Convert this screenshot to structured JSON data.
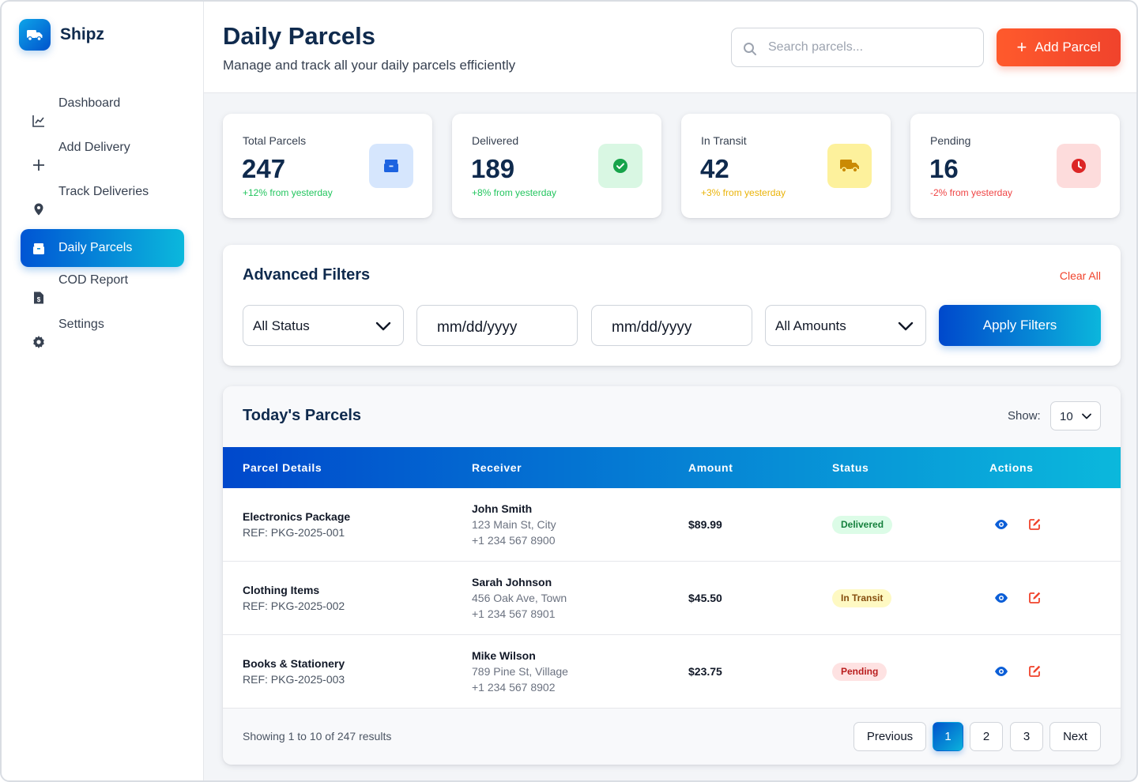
{
  "brand": {
    "name": "Shipz"
  },
  "sidebar": {
    "items": [
      {
        "label": "Dashboard",
        "icon": "chart-line-icon"
      },
      {
        "label": "Add Delivery",
        "icon": "plus-icon"
      },
      {
        "label": "Track Deliveries",
        "icon": "map-pin-icon"
      },
      {
        "label": "Daily Parcels",
        "icon": "box-icon",
        "active": true
      },
      {
        "label": "COD Report",
        "icon": "invoice-dollar-icon"
      },
      {
        "label": "Settings",
        "icon": "gear-icon"
      }
    ]
  },
  "header": {
    "title": "Daily Parcels",
    "subtitle": "Manage and track all your daily parcels efficiently",
    "search_placeholder": "Search parcels...",
    "add_label": "Add Parcel"
  },
  "stats": [
    {
      "label": "Total Parcels",
      "value": "247",
      "change": "+12% from yesterday",
      "color": "#22c55e",
      "icon": "box-icon",
      "icon_bg": "#dbeafe",
      "icon_color": "#1d63e0"
    },
    {
      "label": "Delivered",
      "value": "189",
      "change": "+8% from yesterday",
      "color": "#22c55e",
      "icon": "check-circle-icon",
      "icon_bg": "#d9f7e3",
      "icon_color": "#16a34a"
    },
    {
      "label": "In Transit",
      "value": "42",
      "change": "+3% from yesterday",
      "color": "#eab308",
      "icon": "truck-icon",
      "icon_bg": "#fdf3a8",
      "icon_color": "#ca8a04"
    },
    {
      "label": "Pending",
      "value": "16",
      "change": "-2% from yesterday",
      "color": "#ef4444",
      "icon": "clock-icon",
      "icon_bg": "#fde0e0",
      "icon_color": "#dc2626"
    }
  ],
  "filters": {
    "title": "Advanced Filters",
    "clear_label": "Clear All",
    "status_value": "All Status",
    "date_from": "mm/dd/yyyy",
    "date_to": "mm/dd/yyyy",
    "amount_value": "All Amounts",
    "apply_label": "Apply Filters"
  },
  "table": {
    "title": "Today's Parcels",
    "show_label": "Show:",
    "show_value": "10",
    "columns": [
      "Parcel Details",
      "Receiver",
      "Amount",
      "Status",
      "Actions"
    ],
    "rows": [
      {
        "name": "Electronics Package",
        "ref": "REF: PKG-2025-001",
        "receiver": "John Smith",
        "address": "123 Main St, City",
        "phone": "+1 234 567 8900",
        "amount": "$89.99",
        "status": "Delivered",
        "status_bg": "#dcfce7",
        "status_color": "#15803d"
      },
      {
        "name": "Clothing Items",
        "ref": "REF: PKG-2025-002",
        "receiver": "Sarah Johnson",
        "address": "456 Oak Ave, Town",
        "phone": "+1 234 567 8901",
        "amount": "$45.50",
        "status": "In Transit",
        "status_bg": "#fef9c3",
        "status_color": "#854d0e"
      },
      {
        "name": "Books & Stationery",
        "ref": "REF: PKG-2025-003",
        "receiver": "Mike Wilson",
        "address": "789 Pine St, Village",
        "phone": "+1 234 567 8902",
        "amount": "$23.75",
        "status": "Pending",
        "status_bg": "#fee2e2",
        "status_color": "#b91c1c"
      }
    ],
    "showing_text": "Showing 1 to 10 of 247 results",
    "pagination": {
      "previous": "Previous",
      "pages": [
        "1",
        "2",
        "3"
      ],
      "current": "1",
      "next": "Next"
    }
  }
}
